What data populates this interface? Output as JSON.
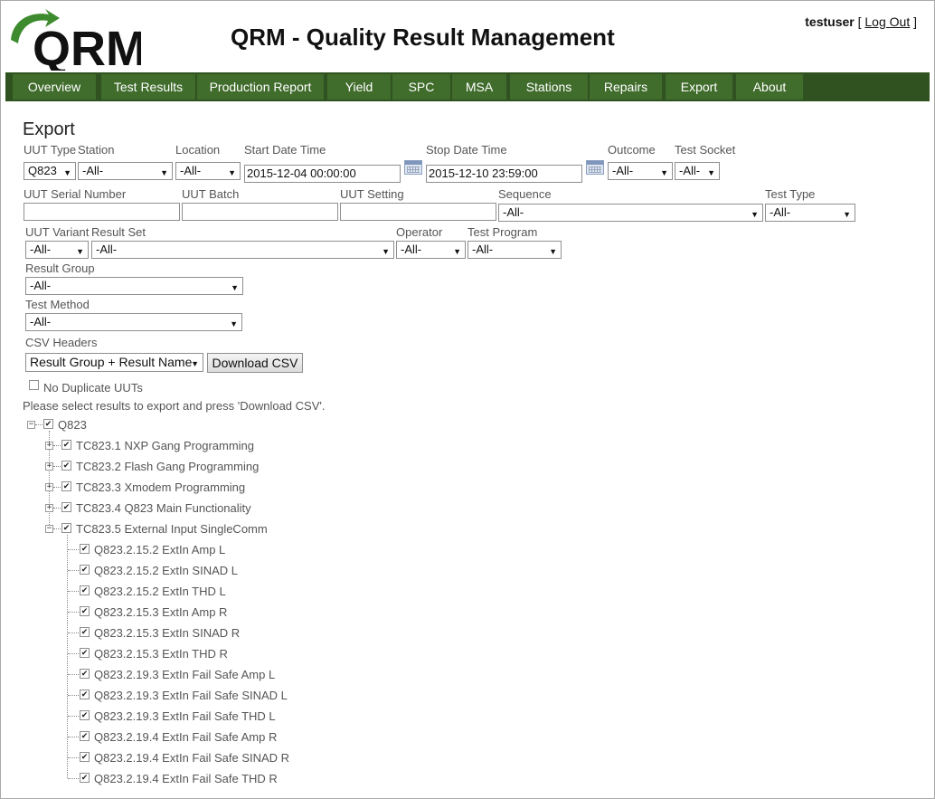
{
  "header": {
    "logo_text": "QRM",
    "app_title": "QRM - Quality Result Management",
    "username": "testuser",
    "logout_label": "Log Out"
  },
  "nav": {
    "tabs": [
      "Overview",
      "Test Results",
      "Production Report",
      "Yield",
      "SPC",
      "MSA",
      "Stations",
      "Repairs",
      "Export",
      "About"
    ]
  },
  "page": {
    "title": "Export"
  },
  "filters": {
    "uut_type": {
      "label": "UUT Type",
      "value": "Q823"
    },
    "station": {
      "label": "Station",
      "value": "-All-"
    },
    "location": {
      "label": "Location",
      "value": "-All-"
    },
    "start_date": {
      "label": "Start Date Time",
      "value": "2015-12-04 00:00:00"
    },
    "stop_date": {
      "label": "Stop Date Time",
      "value": "2015-12-10 23:59:00"
    },
    "outcome": {
      "label": "Outcome",
      "value": "-All-"
    },
    "test_socket": {
      "label": "Test Socket",
      "value": "-All-"
    },
    "uut_serial": {
      "label": "UUT Serial Number",
      "value": ""
    },
    "uut_batch": {
      "label": "UUT Batch",
      "value": ""
    },
    "uut_setting": {
      "label": "UUT Setting",
      "value": ""
    },
    "sequence": {
      "label": "Sequence",
      "value": "-All-"
    },
    "test_type": {
      "label": "Test Type",
      "value": "-All-"
    },
    "uut_variant": {
      "label": "UUT Variant",
      "value": "-All-"
    },
    "result_set": {
      "label": "Result Set",
      "value": "-All-"
    },
    "operator": {
      "label": "Operator",
      "value": "-All-"
    },
    "test_program": {
      "label": "Test Program",
      "value": "-All-"
    },
    "result_group": {
      "label": "Result Group",
      "value": "-All-"
    },
    "test_method": {
      "label": "Test Method",
      "value": "-All-"
    },
    "csv_headers": {
      "label": "CSV Headers",
      "value": "Result Group + Result Name"
    }
  },
  "actions": {
    "download_label": "Download CSV",
    "no_duplicates_label": "No Duplicate UUTs",
    "instruction": "Please select results to export and press 'Download CSV'."
  },
  "tree": {
    "root": "Q823",
    "groups": [
      "TC823.1 NXP Gang Programming",
      "TC823.2 Flash Gang Programming",
      "TC823.3 Xmodem Programming",
      "TC823.4 Q823 Main Functionality",
      "TC823.5 External Input SingleComm"
    ],
    "children": [
      "Q823.2.15.2 ExtIn Amp L",
      "Q823.2.15.2 ExtIn SINAD L",
      "Q823.2.15.2 ExtIn THD L",
      "Q823.2.15.3 ExtIn Amp R",
      "Q823.2.15.3 ExtIn SINAD R",
      "Q823.2.15.3 ExtIn THD R",
      "Q823.2.19.3 ExtIn Fail Safe Amp L",
      "Q823.2.19.3 ExtIn Fail Safe SINAD L",
      "Q823.2.19.3 ExtIn Fail Safe THD L",
      "Q823.2.19.4 ExtIn Fail Safe Amp R",
      "Q823.2.19.4 ExtIn Fail Safe SINAD R",
      "Q823.2.19.4 ExtIn Fail Safe THD R"
    ]
  },
  "colors": {
    "nav_bg": "#2f5220",
    "nav_tab": "#406c2c",
    "logo_green": "#3d8b2e"
  }
}
